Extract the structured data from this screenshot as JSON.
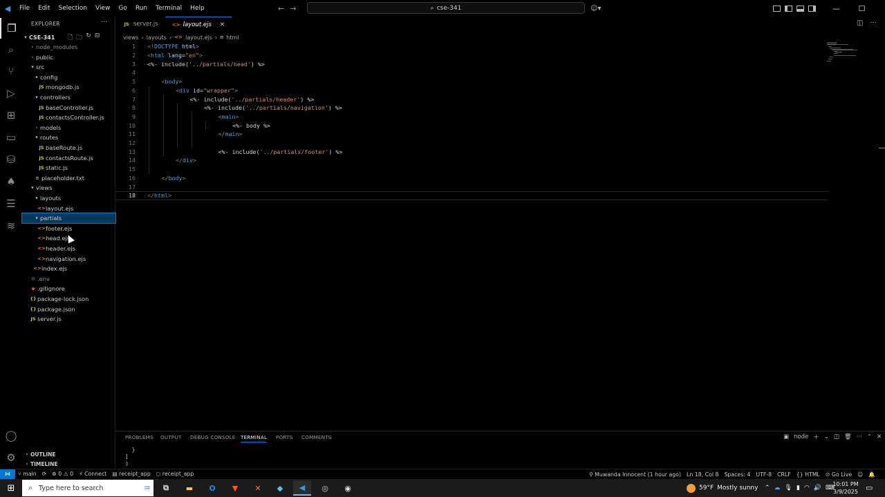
{
  "menu": [
    "File",
    "Edit",
    "Selection",
    "View",
    "Go",
    "Run",
    "Terminal",
    "Help"
  ],
  "command_center": {
    "text": "cse-341"
  },
  "window_buttons": {
    "minimize": "—",
    "maximize": "☐",
    "close": "✕"
  },
  "explorer": {
    "header": "EXPLORER",
    "root": "CSE-341",
    "tree": [
      {
        "label": "node_modules",
        "type": "folder",
        "open": false,
        "depth": 1,
        "dim": true
      },
      {
        "label": "public",
        "type": "folder",
        "open": false,
        "depth": 1
      },
      {
        "label": "src",
        "type": "folder",
        "open": true,
        "depth": 1
      },
      {
        "label": "config",
        "type": "folder",
        "open": true,
        "depth": 2
      },
      {
        "label": "mongodb.js",
        "type": "js",
        "depth": 3
      },
      {
        "label": "controllers",
        "type": "folder",
        "open": true,
        "depth": 2
      },
      {
        "label": "baseController.js",
        "type": "js",
        "depth": 3
      },
      {
        "label": "contactsController.js",
        "type": "js",
        "depth": 3
      },
      {
        "label": "models",
        "type": "folder",
        "open": false,
        "depth": 2
      },
      {
        "label": "routes",
        "type": "folder",
        "open": true,
        "depth": 2
      },
      {
        "label": "baseRoute.js",
        "type": "js",
        "depth": 3
      },
      {
        "label": "contactsRoute.js",
        "type": "js",
        "depth": 3
      },
      {
        "label": "static.js",
        "type": "js",
        "depth": 3
      },
      {
        "label": "placeholder.txt",
        "type": "txt",
        "depth": 2
      },
      {
        "label": "views",
        "type": "folder",
        "open": true,
        "depth": 1
      },
      {
        "label": "layouts",
        "type": "folder",
        "open": true,
        "depth": 2
      },
      {
        "label": "layout.ejs",
        "type": "ejs",
        "depth": 3
      },
      {
        "label": "partials",
        "type": "folder",
        "open": true,
        "depth": 2,
        "selected": true
      },
      {
        "label": "footer.ejs",
        "type": "ejs",
        "depth": 3
      },
      {
        "label": "head.ejs",
        "type": "ejs",
        "depth": 3
      },
      {
        "label": "header.ejs",
        "type": "ejs",
        "depth": 3
      },
      {
        "label": "navigation.ejs",
        "type": "ejs",
        "depth": 3
      },
      {
        "label": "index.ejs",
        "type": "ejs",
        "depth": 2
      },
      {
        "label": ".env",
        "type": "env",
        "depth": 1,
        "dim": true
      },
      {
        "label": ".gitignore",
        "type": "git",
        "depth": 1
      },
      {
        "label": "package-lock.json",
        "type": "json",
        "depth": 1
      },
      {
        "label": "package.json",
        "type": "json",
        "depth": 1
      },
      {
        "label": "server.js",
        "type": "js",
        "depth": 1
      }
    ],
    "outline": "OUTLINE",
    "timeline": "TIMELINE"
  },
  "tabs": [
    {
      "label": "server.js",
      "type": "js",
      "active": false
    },
    {
      "label": "layout.ejs",
      "type": "ejs",
      "active": true
    }
  ],
  "breadcrumb": [
    "views",
    "layouts",
    "layout.ejs",
    "html"
  ],
  "editor": {
    "current_line": 18,
    "lines": [
      {
        "n": 1,
        "indent": 0,
        "parts": [
          [
            "t-tag",
            "<!"
          ],
          [
            "t-name",
            "DOCTYPE"
          ],
          [
            "t-ejs",
            " "
          ],
          [
            "t-attr",
            "html"
          ],
          [
            "t-tag",
            ">"
          ]
        ]
      },
      {
        "n": 2,
        "indent": 0,
        "parts": [
          [
            "t-tag",
            "<"
          ],
          [
            "t-name",
            "html"
          ],
          [
            "t-ejs",
            " "
          ],
          [
            "t-attr",
            "lang"
          ],
          [
            "t-ejs",
            "="
          ],
          [
            "t-str",
            "\"en\""
          ],
          [
            "t-tag",
            ">"
          ]
        ]
      },
      {
        "n": 3,
        "indent": 0,
        "parts": [
          [
            "t-ejs",
            "<%- include("
          ],
          [
            "t-str",
            "'../partials/head'"
          ],
          [
            "t-ejs",
            ") %>"
          ]
        ]
      },
      {
        "n": 4,
        "indent": 0,
        "parts": []
      },
      {
        "n": 5,
        "indent": 1,
        "parts": [
          [
            "t-tag",
            "<"
          ],
          [
            "t-name",
            "body"
          ],
          [
            "t-tag",
            ">"
          ]
        ]
      },
      {
        "n": 6,
        "indent": 2,
        "parts": [
          [
            "t-tag",
            "<"
          ],
          [
            "t-name",
            "div"
          ],
          [
            "t-ejs",
            " "
          ],
          [
            "t-attr",
            "id"
          ],
          [
            "t-ejs",
            "="
          ],
          [
            "t-str",
            "\"wrapper\""
          ],
          [
            "t-tag",
            ">"
          ]
        ]
      },
      {
        "n": 7,
        "indent": 3,
        "parts": [
          [
            "t-ejs",
            "<%- include("
          ],
          [
            "t-str",
            "'../partials/header'"
          ],
          [
            "t-ejs",
            ") %>"
          ]
        ]
      },
      {
        "n": 8,
        "indent": 4,
        "parts": [
          [
            "t-ejs",
            "<%- include("
          ],
          [
            "t-str",
            "'../partials/navigation'"
          ],
          [
            "t-ejs",
            ") %>"
          ]
        ]
      },
      {
        "n": 9,
        "indent": 5,
        "parts": [
          [
            "t-tag",
            "<"
          ],
          [
            "t-name",
            "main"
          ],
          [
            "t-tag",
            ">"
          ]
        ]
      },
      {
        "n": 10,
        "indent": 6,
        "parts": [
          [
            "t-ejs",
            "<%- body %>"
          ]
        ]
      },
      {
        "n": 11,
        "indent": 5,
        "parts": [
          [
            "t-tag",
            "</"
          ],
          [
            "t-name",
            "main"
          ],
          [
            "t-tag",
            ">"
          ]
        ]
      },
      {
        "n": 12,
        "indent": 0,
        "parts": []
      },
      {
        "n": 13,
        "indent": 5,
        "parts": [
          [
            "t-ejs",
            "<%- include("
          ],
          [
            "t-str",
            "'../partials/footer'"
          ],
          [
            "t-ejs",
            ") %>"
          ]
        ]
      },
      {
        "n": 14,
        "indent": 2,
        "parts": [
          [
            "t-tag",
            "</"
          ],
          [
            "t-name",
            "div"
          ],
          [
            "t-tag",
            ">"
          ]
        ]
      },
      {
        "n": 15,
        "indent": 0,
        "parts": []
      },
      {
        "n": 16,
        "indent": 1,
        "parts": [
          [
            "t-tag",
            "</"
          ],
          [
            "t-name",
            "body"
          ],
          [
            "t-tag",
            ">"
          ]
        ]
      },
      {
        "n": 17,
        "indent": 0,
        "parts": []
      },
      {
        "n": 18,
        "indent": 0,
        "parts": [
          [
            "t-tag",
            "</"
          ],
          [
            "t-name",
            "html"
          ],
          [
            "t-tag",
            ">"
          ]
        ]
      }
    ]
  },
  "panel": {
    "tabs": [
      "PROBLEMS",
      "OUTPUT",
      "DEBUG CONSOLE",
      "TERMINAL",
      "PORTS",
      "COMMENTS"
    ],
    "active_tab": "TERMINAL",
    "terminal_name": "node",
    "terminal_lines": [
      "  }",
      "]",
      "▯"
    ]
  },
  "statusbar": {
    "branch": "main",
    "sync": "⟳",
    "errors": "0",
    "warnings": "0",
    "connect": "Connect",
    "workspace1": "receipt_app",
    "workspace2": "receipt_app",
    "blame": "Muwanda Innocent (1 hour ago)",
    "position": "Ln 18, Col 8",
    "spaces": "Spaces: 4",
    "encoding": "UTF-8",
    "eol": "CRLF",
    "language": "HTML",
    "golive": "Go Live"
  },
  "taskbar": {
    "search_placeholder": "Type here to search",
    "weather_temp": "59°F",
    "weather_desc": "Mostly sunny",
    "time": "10:01 PM",
    "date": "3/9/2025"
  },
  "colors": {
    "accent": "#0078d4",
    "selection": "#04395e",
    "js": "#cbcb41",
    "ejs": "#e37933"
  }
}
